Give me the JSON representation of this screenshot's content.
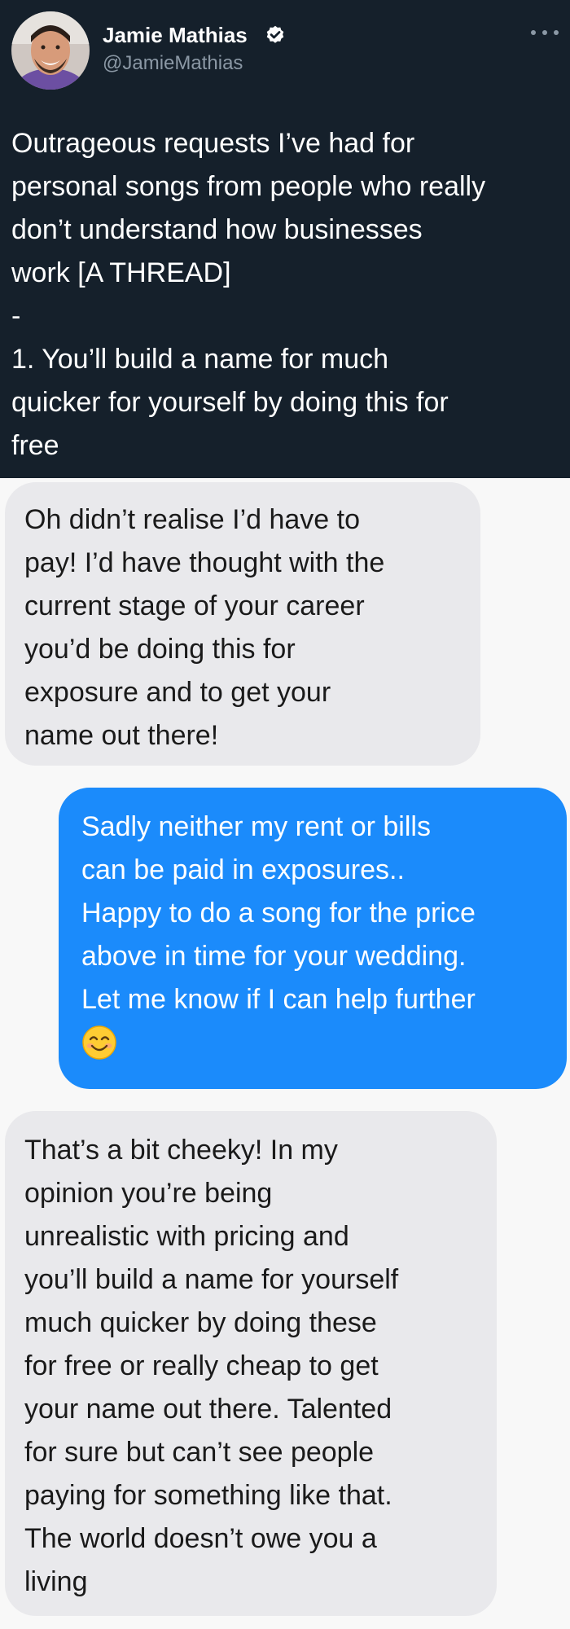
{
  "tweet": {
    "author": {
      "name": "Jamie Mathias",
      "handle": "@JamieMathias",
      "verified": true,
      "avatar": "profile-photo"
    },
    "more_icon": "more-dots-icon",
    "text_lines": [
      "Outrageous requests I’ve had for",
      "personal songs from people who really",
      "don’t understand how businesses",
      "work [A THREAD]",
      "-",
      "1. You’ll build a name for much",
      "quicker for yourself by doing this for",
      "free"
    ]
  },
  "messages": [
    {
      "direction": "received",
      "lines": [
        "Oh didn’t realise I’d have to",
        "pay! I’d have thought with the",
        "current stage of your career",
        "you’d be doing this for",
        "exposure and to get your",
        "name out there!"
      ]
    },
    {
      "direction": "sent",
      "lines": [
        "Sadly neither my rent or bills",
        "can be paid in exposures..",
        "Happy to do a song for the price",
        "above in time for your wedding.",
        "Let me know if I can help further"
      ],
      "emoji": "smiling-face-emoji"
    },
    {
      "direction": "received",
      "lines": [
        "That’s a bit cheeky! In my",
        "opinion you’re being",
        "unrealistic with pricing and",
        "you’ll build a name for yourself",
        "much quicker by doing these",
        "for free or really cheap to get",
        "your name out there. Talented",
        "for sure but can’t see people",
        "paying for something like that.",
        "The world doesn’t owe you a",
        "living"
      ]
    }
  ],
  "colors": {
    "tweet_bg": "#15202b",
    "handle_gray": "#8b98a5",
    "received_bubble": "#e9e9ec",
    "sent_bubble": "#1b8bfb",
    "chat_bg": "#f8f8f8"
  }
}
